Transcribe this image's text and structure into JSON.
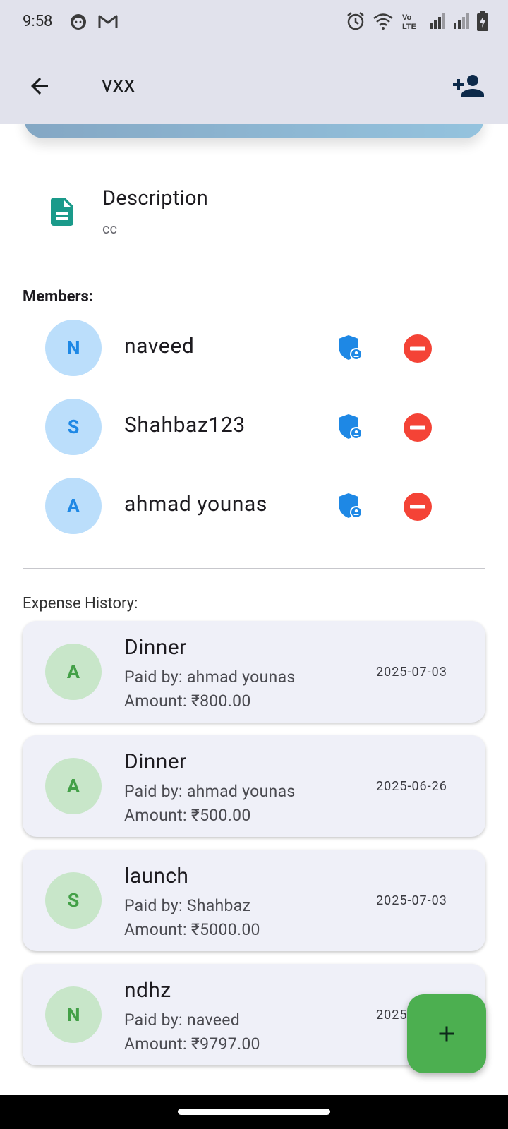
{
  "status_bar": {
    "time": "9:58",
    "left_icons": [
      "face-notification-icon",
      "gmail-icon"
    ],
    "right_icons": [
      "alarm-icon",
      "wifi-icon",
      "volte-icon",
      "signal-icon",
      "signal-2-icon",
      "battery-charging-icon"
    ]
  },
  "app_bar": {
    "title": "vxx",
    "back_icon": "arrow-left-icon",
    "action_icon": "person-add-icon"
  },
  "description": {
    "title": "Description",
    "text": "cc",
    "icon": "document-icon"
  },
  "members": {
    "label": "Members:",
    "items": [
      {
        "initial": "N",
        "name": "naveed"
      },
      {
        "initial": "S",
        "name": "Shahbaz123"
      },
      {
        "initial": "A",
        "name": "ahmad younas"
      }
    ]
  },
  "expense_history": {
    "label": "Expense History:",
    "items": [
      {
        "initial": "A",
        "title": "Dinner",
        "paid_by": "Paid by: ahmad younas",
        "amount": "Amount: ₹800.00",
        "date": "2025-07-03"
      },
      {
        "initial": "A",
        "title": "Dinner",
        "paid_by": "Paid by: ahmad younas",
        "amount": "Amount: ₹500.00",
        "date": "2025-06-26"
      },
      {
        "initial": "S",
        "title": "launch",
        "paid_by": "Paid by: Shahbaz",
        "amount": "Amount: ₹5000.00",
        "date": "2025-07-03"
      },
      {
        "initial": "N",
        "title": "ndhz",
        "paid_by": "Paid by: naveed",
        "amount": "Amount: ₹9797.00",
        "date": "2025"
      }
    ]
  },
  "fab": {
    "icon": "plus-icon"
  },
  "colors": {
    "app_bar_bg": "#e1e2ec",
    "member_avatar_bg": "#bbdefb",
    "member_avatar_fg": "#1e88e5",
    "expense_avatar_bg": "#c8e6c9",
    "expense_avatar_fg": "#43a047",
    "remove_red": "#f44336",
    "admin_blue": "#1e88e5",
    "fab_green": "#4caf50",
    "description_icon": "#1a9a8a"
  }
}
